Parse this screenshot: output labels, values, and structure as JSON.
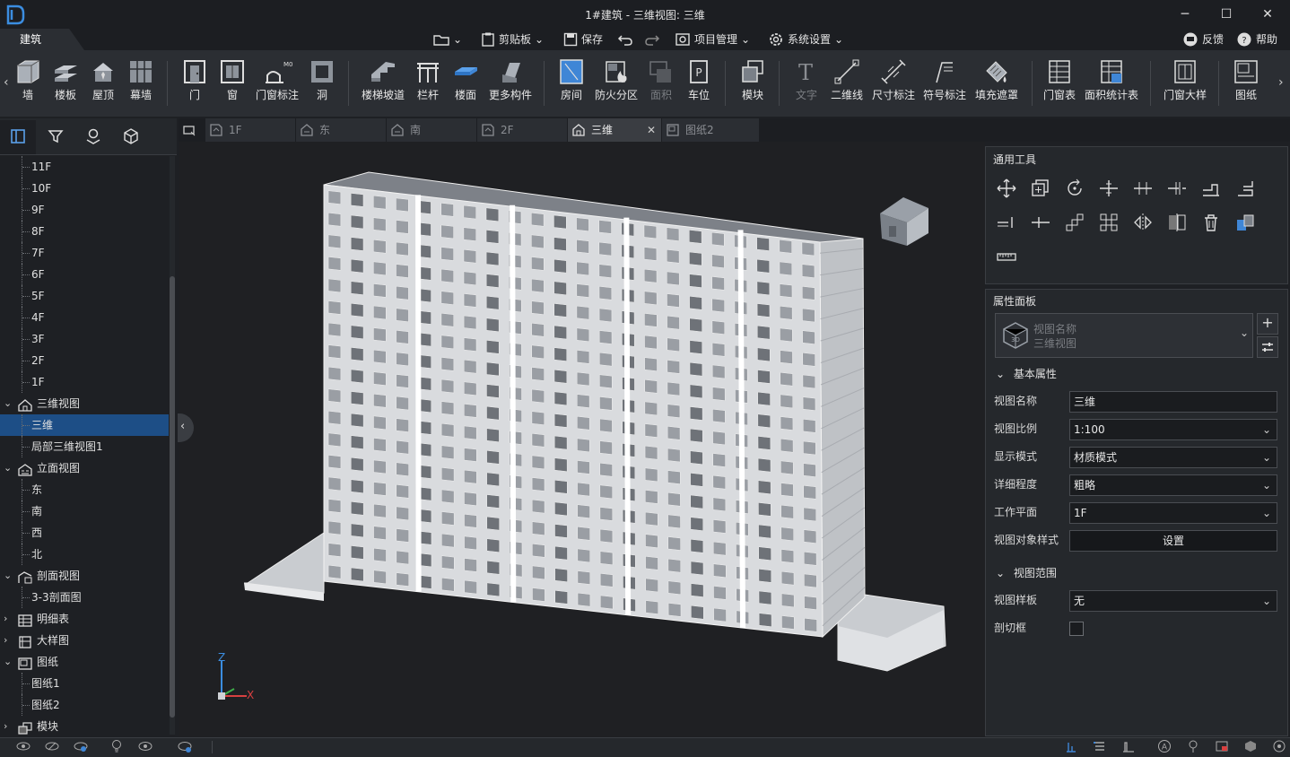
{
  "window": {
    "title": "1#建筑 - 三维视图: 三维",
    "controls": [
      "minimize",
      "maximize",
      "close"
    ]
  },
  "menubar": {
    "active_tab": "建筑",
    "items": [
      {
        "label": "",
        "icon": "folder-open-icon"
      },
      {
        "label": "剪贴板",
        "icon": "clipboard-icon"
      },
      {
        "label": "保存",
        "icon": "save-icon"
      },
      {
        "label": "",
        "icon": "undo-icon"
      },
      {
        "label": "",
        "icon": "redo-icon"
      },
      {
        "label": "项目管理",
        "icon": "gear-icon"
      },
      {
        "label": "系统设置",
        "icon": "settings-icon"
      }
    ],
    "feedback": "反馈",
    "help": "帮助"
  },
  "ribbon": {
    "groups": [
      [
        {
          "label": "墙",
          "icon": "wall-icon"
        },
        {
          "label": "楼板",
          "icon": "slab-icon"
        },
        {
          "label": "屋顶",
          "icon": "roof-icon"
        },
        {
          "label": "幕墙",
          "icon": "curtain-wall-icon"
        }
      ],
      [
        {
          "label": "门",
          "icon": "door-icon"
        },
        {
          "label": "窗",
          "icon": "window-icon"
        },
        {
          "label": "门窗标注",
          "icon": "door-window-tag-icon",
          "badge": "M01"
        },
        {
          "label": "洞",
          "icon": "opening-icon"
        }
      ],
      [
        {
          "label": "楼梯坡道",
          "icon": "stair-icon"
        },
        {
          "label": "栏杆",
          "icon": "railing-icon"
        },
        {
          "label": "楼面",
          "icon": "floor-icon"
        },
        {
          "label": "更多构件",
          "icon": "more-components-icon"
        }
      ],
      [
        {
          "label": "房间",
          "icon": "room-icon"
        },
        {
          "label": "防火分区",
          "icon": "fire-zone-icon"
        },
        {
          "label": "面积",
          "icon": "area-icon",
          "disabled": true
        },
        {
          "label": "车位",
          "icon": "parking-icon"
        }
      ],
      [
        {
          "label": "模块",
          "icon": "module-icon"
        }
      ],
      [
        {
          "label": "文字",
          "icon": "text-icon",
          "disabled": true
        },
        {
          "label": "二维线",
          "icon": "line-2d-icon"
        },
        {
          "label": "尺寸标注",
          "icon": "dimension-icon"
        },
        {
          "label": "符号标注",
          "icon": "symbol-icon"
        },
        {
          "label": "填充遮罩",
          "icon": "fill-mask-icon"
        }
      ],
      [
        {
          "label": "门窗表",
          "icon": "door-window-table-icon"
        },
        {
          "label": "面积统计表",
          "icon": "area-table-icon"
        }
      ],
      [
        {
          "label": "门窗大样",
          "icon": "door-window-detail-icon"
        }
      ],
      [
        {
          "label": "图纸",
          "icon": "drawing-icon"
        }
      ]
    ]
  },
  "left_panel": {
    "tools": [
      "panel-icon",
      "filter-icon",
      "location-icon",
      "cube-icon"
    ],
    "tree": [
      {
        "label": "11F",
        "level": 1
      },
      {
        "label": "10F",
        "level": 1
      },
      {
        "label": "9F",
        "level": 1
      },
      {
        "label": "8F",
        "level": 1
      },
      {
        "label": "7F",
        "level": 1
      },
      {
        "label": "6F",
        "level": 1
      },
      {
        "label": "5F",
        "level": 1
      },
      {
        "label": "4F",
        "level": 1
      },
      {
        "label": "3F",
        "level": 1
      },
      {
        "label": "2F",
        "level": 1
      },
      {
        "label": "1F",
        "level": 1
      },
      {
        "label": "三维视图",
        "level": 0,
        "icon": "house-3d-icon",
        "expanded": true
      },
      {
        "label": "三维",
        "level": 1,
        "selected": true
      },
      {
        "label": "局部三维视图1",
        "level": 1
      },
      {
        "label": "立面视图",
        "level": 0,
        "icon": "elevation-icon",
        "expanded": true
      },
      {
        "label": "东",
        "level": 1
      },
      {
        "label": "南",
        "level": 1
      },
      {
        "label": "西",
        "level": 1
      },
      {
        "label": "北",
        "level": 1
      },
      {
        "label": "剖面视图",
        "level": 0,
        "icon": "section-icon",
        "expanded": true
      },
      {
        "label": "3-3剖面图",
        "level": 1
      },
      {
        "label": "明细表",
        "level": 0,
        "icon": "schedule-icon"
      },
      {
        "label": "大样图",
        "level": 0,
        "icon": "detail-icon"
      },
      {
        "label": "图纸",
        "level": 0,
        "icon": "sheet-icon",
        "expanded": true
      },
      {
        "label": "图纸1",
        "level": 1
      },
      {
        "label": "图纸2",
        "level": 1
      },
      {
        "label": "模块",
        "level": 0,
        "icon": "module-icon",
        "expanded": false
      }
    ]
  },
  "doc_tabs": [
    {
      "label": "1F",
      "icon": "plan-icon"
    },
    {
      "label": "东",
      "icon": "elevation-icon"
    },
    {
      "label": "南",
      "icon": "elevation-icon"
    },
    {
      "label": "2F",
      "icon": "plan-icon"
    },
    {
      "label": "三维",
      "icon": "house-3d-icon",
      "active": true,
      "closable": true
    },
    {
      "label": "图纸2",
      "icon": "sheet-icon"
    }
  ],
  "viewport": {
    "axis": {
      "z": "Z",
      "x": "X"
    }
  },
  "tools_panel": {
    "title": "通用工具",
    "tools": [
      "move-icon",
      "copy-icon",
      "rotate-icon",
      "split-icon",
      "align-icon",
      "offset-icon",
      "extend-icon",
      "trim-icon",
      "array-linear-icon",
      "array-split-icon",
      "array-diagonal-icon",
      "array-grid-icon",
      "mirror-icon",
      "mirror-axis-icon",
      "delete-icon",
      "material-icon",
      "measure-icon"
    ]
  },
  "props_panel": {
    "title": "属性面板",
    "type_label": "视图名称",
    "type_value": "三维视图",
    "sections": [
      {
        "title": "基本属性",
        "rows": [
          {
            "label": "视图名称",
            "value": "三维",
            "kind": "text"
          },
          {
            "label": "视图比例",
            "value": "1:100",
            "kind": "select"
          },
          {
            "label": "显示模式",
            "value": "材质模式",
            "kind": "select"
          },
          {
            "label": "详细程度",
            "value": "粗略",
            "kind": "select"
          },
          {
            "label": "工作平面",
            "value": "1F",
            "kind": "select"
          },
          {
            "label": "视图对象样式",
            "value": "设置",
            "kind": "button"
          }
        ]
      },
      {
        "title": "视图范围",
        "rows": [
          {
            "label": "视图样板",
            "value": "无",
            "kind": "select"
          },
          {
            "label": "剖切框",
            "value": "",
            "kind": "checkbox"
          }
        ]
      }
    ]
  },
  "statusbar": {
    "left_icons": [
      "visibility-icon",
      "visibility-2-icon",
      "visibility-3-icon",
      "bulb-icon",
      "eye-icon",
      "eye-settings-icon"
    ],
    "right_icons": [
      "snap-icon",
      "list-icon",
      "level-icon",
      "a-icon",
      "pin-icon",
      "image-icon",
      "cube-icon",
      "target-icon"
    ]
  },
  "colors": {
    "accent": "#1d4e86",
    "selected_tab": "#3a3d42",
    "background": "#1e2024"
  }
}
